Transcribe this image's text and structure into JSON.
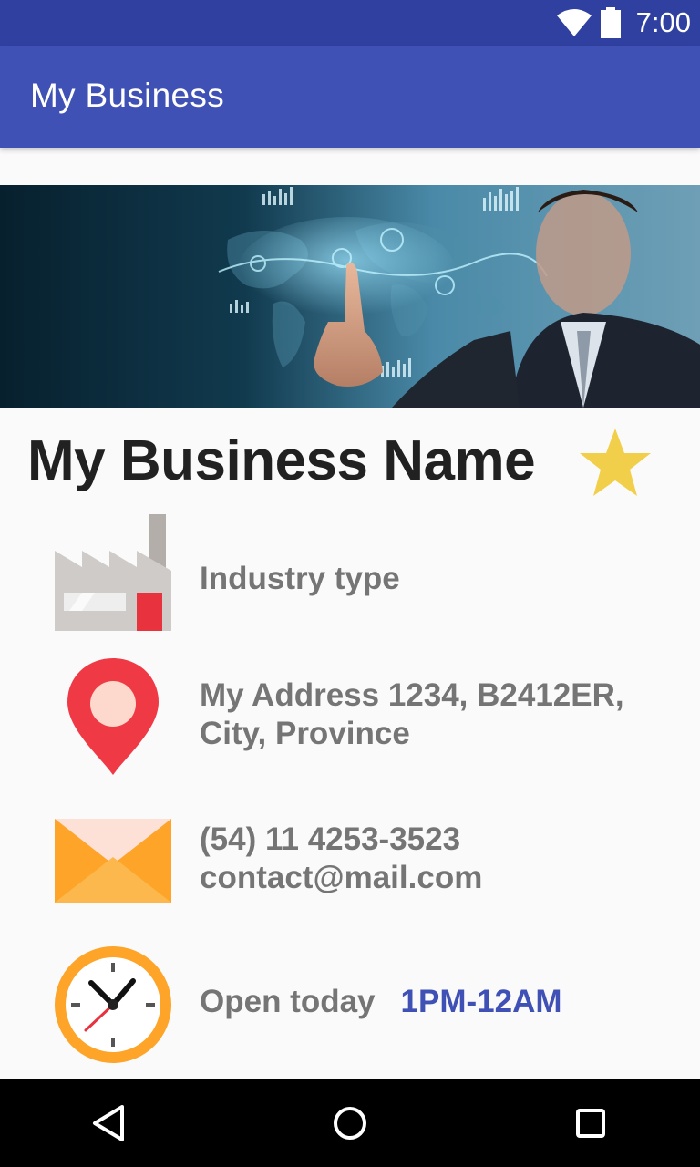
{
  "status_bar": {
    "time": "7:00",
    "icons": [
      "wifi-icon",
      "battery-icon"
    ]
  },
  "app_bar": {
    "title": "My Business",
    "color": "#3f51b5"
  },
  "business": {
    "name": "My Business Name",
    "favorite_icon": "star-icon",
    "industry": "Industry type",
    "address_line1": "My Address 1234, B2412ER,",
    "address_line2": "City, Province",
    "phone": "(54) 11 4253-3523",
    "email": "contact@mail.com",
    "hours_label": "Open today",
    "hours_value": "1PM-12AM"
  },
  "icons": {
    "industry": "factory-icon",
    "address": "location-pin-icon",
    "contact": "envelope-icon",
    "hours": "clock-icon"
  },
  "nav_bar": {
    "buttons": [
      "back-icon",
      "home-icon",
      "recents-icon"
    ]
  },
  "colors": {
    "status_bar": "#3040a0",
    "accent_text": "#3f51b5",
    "star": "#f2cf4a",
    "pin": "#ef3a45",
    "envelope": "#fda429",
    "clock": "#fda429"
  }
}
